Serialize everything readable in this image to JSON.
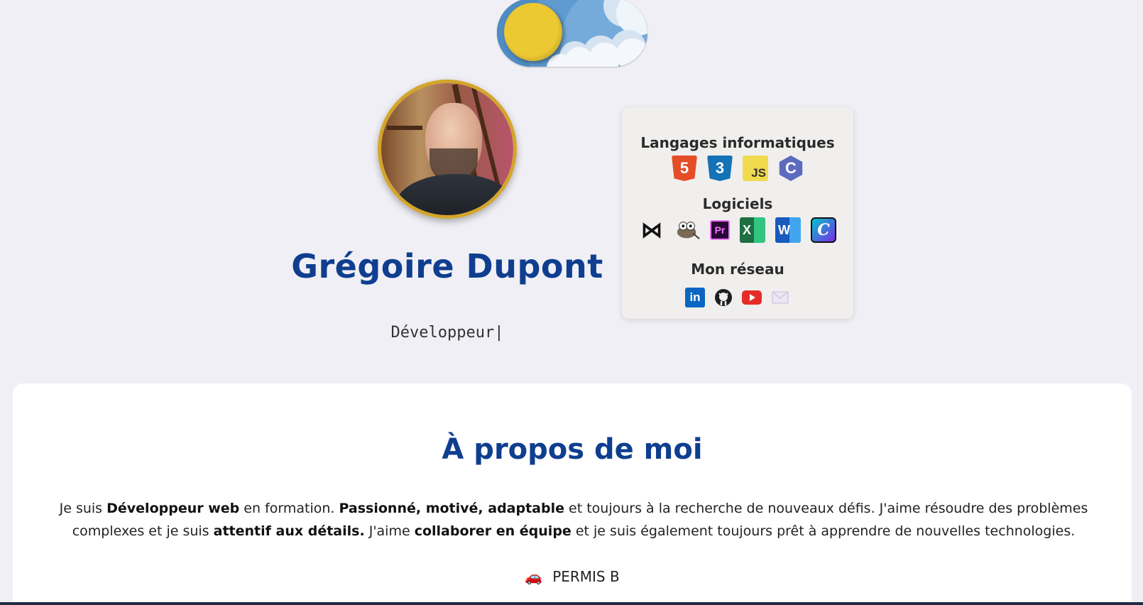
{
  "theme_toggle": {
    "state": "light",
    "sun_color": "#ecc832",
    "sky_color": "#3f7db8"
  },
  "profile": {
    "name": "Grégoire Dupont",
    "role": "Développeur|",
    "name_color": "#0f3e8f"
  },
  "skills": {
    "languages_title": "Langages informatiques",
    "languages": [
      {
        "icon": "html5-icon",
        "label": "5"
      },
      {
        "icon": "css3-icon",
        "label": "3"
      },
      {
        "icon": "javascript-icon",
        "label": "JS"
      },
      {
        "icon": "c-language-icon",
        "label": "C"
      }
    ],
    "software_title": "Logiciels",
    "software": [
      {
        "icon": "vscode-icon"
      },
      {
        "icon": "gimp-icon"
      },
      {
        "icon": "premiere-pro-icon",
        "label": "Pr"
      },
      {
        "icon": "excel-icon",
        "label": "X"
      },
      {
        "icon": "word-icon",
        "label": "W"
      },
      {
        "icon": "canva-icon",
        "label": "C"
      }
    ],
    "network_title": "Mon réseau",
    "network": [
      {
        "icon": "linkedin-icon",
        "label": "in"
      },
      {
        "icon": "github-icon"
      },
      {
        "icon": "youtube-icon"
      },
      {
        "icon": "email-icon"
      }
    ]
  },
  "about": {
    "title": "À propos de moi",
    "p_1": "Je suis ",
    "b_1": "Développeur web",
    "p_2": " en formation. ",
    "b_2": "Passionné, motivé, adaptable",
    "p_3": " et toujours à la recherche de nouveaux défis. J'aime résoudre des problèmes complexes et je suis ",
    "b_3": "attentif aux détails.",
    "p_4": " J'aime ",
    "b_4": "collaborer en équipe",
    "p_5": " et je suis également toujours prêt à apprendre de nouvelles technologies.",
    "permis_icon": "🚗",
    "permis": "PERMIS B"
  }
}
